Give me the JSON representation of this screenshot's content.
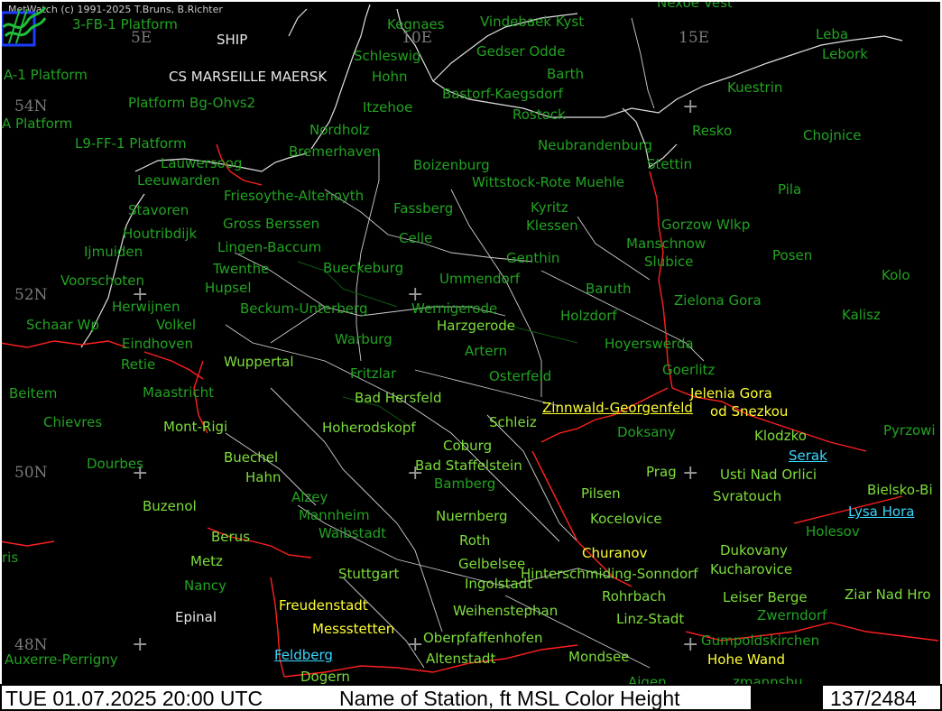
{
  "credit": "MetWatch  (c) 1991-2025 T.Bruns, B.Richter",
  "status": {
    "time": "TUE 01.07.2025 20:00 UTC",
    "legend": "Name of Station,  ft MSL Color Height",
    "frame": "137/2484"
  },
  "grid_labels": [
    "5E",
    "10E",
    "15E",
    "54N",
    "52N",
    "50N",
    "48N"
  ],
  "ship_labels": [
    "SHIP",
    "CS MARSEILLE MAERSK"
  ],
  "colors": {
    "background": "#000000",
    "station_green": "#22a322",
    "station_lightgreen": "#7dde3a",
    "station_yellow": "#ffff33",
    "station_cyan": "#3ad6ff",
    "coast": "#ffffff",
    "border": "#ff2020"
  },
  "stations": {
    "fb1": "3-FB-1 Platform",
    "a1": "A-1 Platform",
    "apl": "A Platform",
    "bg": "Platform Bg-Ohvs2",
    "l9": "L9-FF-1 Platform",
    "kegnaes": "Kegnaes",
    "vindebaek": "Vindebaek Kyst",
    "schleswig": "Schleswig",
    "gedser": "Gedser Odde",
    "hohn": "Hohn",
    "barth": "Barth",
    "bastorf": "Bastorf-Kaegsdorf",
    "itzehoe": "Itzehoe",
    "rostock": "Rostock",
    "nordholz": "Nordholz",
    "bremerhaven": "Bremerhaven",
    "neubrandenburg": "Neubrandenburg",
    "lauwersoog": "Lauwersoog",
    "boizenburg": "Boizenburg",
    "stettin": "Stettin",
    "leeuwarden": "Leeuwarden",
    "wittstock": "Wittstock-Rote Muehle",
    "friesoythe": "Friesoythe-Altenoyth",
    "stavoren": "Stavoren",
    "fassberg": "Fassberg",
    "kyritz": "Kyritz",
    "gross": "Gross Berssen",
    "klessen": "Klessen",
    "gorzow": "Gorzow Wlkp",
    "houtribdijk": "Houtribdijk",
    "celle": "Celle",
    "lingen": "Lingen-Baccum",
    "manschnow": "Manschnow",
    "ijmuiden": "Ijmuiden",
    "genthin": "Genthin",
    "slubice": "Slubice",
    "twenthe": "Twenthe",
    "bueckeburg": "Bueckeburg",
    "voorschoten": "Voorschoten",
    "ummendorf": "Ummendorf",
    "hupsel": "Hupsel",
    "baruth": "Baruth",
    "zielona": "Zielona Gora",
    "herwijnen": "Herwijnen",
    "beckum": "Beckum-Unterberg",
    "wernigerode": "Wernigerode",
    "holzdorf": "Holzdorf",
    "schaar": "Schaar Wp",
    "volkel": "Volkel",
    "harzgerode": "Harzgerode",
    "eindhoven": "Eindhoven",
    "warburg": "Warburg",
    "hoyerswerda": "Hoyerswerda",
    "artern": "Artern",
    "retie": "Retie",
    "wuppertal": "Wuppertal",
    "fritzlar": "Fritzlar",
    "osterfeld": "Osterfeld",
    "goerlitz": "Goerlitz",
    "beitem": "Beitem",
    "maastricht": "Maastricht",
    "badhersfeld": "Bad Hersfeld",
    "zinnwald": "Zinnwald-Georgenfeld",
    "jelenia": "Jelenia Gora",
    "snezkou": "od Snezkou",
    "chievres": "Chievres",
    "montrigi": "Mont-Rigi",
    "hoherodskopf": "Hoherodskopf",
    "schleiz": "Schleiz",
    "doksany": "Doksany",
    "klodzko": "Klodzko",
    "pyrzowi": "Pyrzowi",
    "coburg": "Coburg",
    "buechel": "Buechel",
    "serak": "Serak",
    "dourbes": "Dourbes",
    "badstaffelstein": "Bad Staffelstein",
    "prag": "Prag",
    "usti": "Usti Nad Orlici",
    "hahn": "Hahn",
    "bamberg": "Bamberg",
    "bielsko": "Bielsko-Bi",
    "pilsen": "Pilsen",
    "svratouch": "Svratouch",
    "alzey": "Alzey",
    "buzenol": "Buzenol",
    "lysa": "Lysa Hora",
    "mannheim": "Mannheim",
    "nuernberg": "Nuernberg",
    "kocelovice": "Kocelovice",
    "waibstadt": "Waibstadt",
    "holesov": "Holesov",
    "berus": "Berus",
    "roth": "Roth",
    "churanov": "Churanov",
    "dukovany": "Dukovany",
    "ris": "ris",
    "metz": "Metz",
    "gelbelsee": "Gelbelsee",
    "kucharovice": "Kucharovice",
    "hinterschmiding": "Hinterschmiding-Sonndorf",
    "stuttgart": "Stuttgart",
    "ingolstadt": "Ingolstadt",
    "nancy": "Nancy",
    "rohrbach": "Rohrbach",
    "leiser": "Leiser Berge",
    "ziar": "Ziar Nad Hro",
    "freudenstadt": "Freudenstadt",
    "weihenstephan": "Weihenstephan",
    "zwerndorf": "Zwerndorf",
    "epinal": "Epinal",
    "linz": "Linz-Stadt",
    "messstetten": "Messstetten",
    "oberpfaffenhofen": "Oberpfaffenhofen",
    "gumpoldskirchen": "Gumpoldskirchen",
    "feldberg": "Feldberg",
    "auxerre": "Auxerre-Perrigny",
    "altenstadt": "Altenstadt",
    "mondsee": "Mondsee",
    "hohewand": "Hohe Wand",
    "dogern": "Dogern",
    "zmannsb": "zmannsbu",
    "aigen": "Aigen",
    "nexoe": "Nexoe Vest",
    "leba": "Leba",
    "lebork": "Lebork",
    "kuestrin": "Kuestrin",
    "resko": "Resko",
    "chojnice": "Chojnice",
    "pila": "Pila",
    "posen": "Posen",
    "kolo": "Kolo",
    "kalisz": "Kalisz"
  }
}
